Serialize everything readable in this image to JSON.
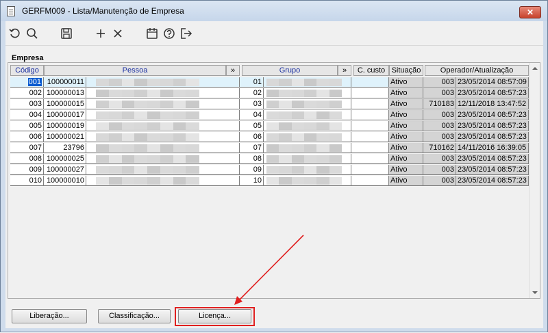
{
  "window": {
    "title": "GERFM009 - Lista/Manutenção de Empresa",
    "close_label": "✕"
  },
  "toolbar": {
    "icons": [
      "refresh-icon",
      "search-icon",
      "save-icon",
      "add-icon",
      "delete-icon",
      "calendar-icon",
      "help-icon",
      "exit-icon"
    ]
  },
  "group": {
    "label": "Empresa"
  },
  "grid": {
    "headers": {
      "codigo": "Código",
      "pessoa": "Pessoa",
      "pessoa_more": "»",
      "grupo": "Grupo",
      "grupo_more": "»",
      "ccusto": "C. custo",
      "situacao": "Situação",
      "operador": "Operador/Atualização"
    },
    "rows": [
      {
        "codigo": "001",
        "pessoa_id": "100000011",
        "grupo": "01",
        "situacao": "Ativo",
        "operador": "003",
        "atualizacao": "23/05/2014 08:57:09"
      },
      {
        "codigo": "002",
        "pessoa_id": "100000013",
        "grupo": "02",
        "situacao": "Ativo",
        "operador": "003",
        "atualizacao": "23/05/2014 08:57:23"
      },
      {
        "codigo": "003",
        "pessoa_id": "100000015",
        "grupo": "03",
        "situacao": "Ativo",
        "operador": "710183",
        "atualizacao": "12/11/2018 13:47:52"
      },
      {
        "codigo": "004",
        "pessoa_id": "100000017",
        "grupo": "04",
        "situacao": "Ativo",
        "operador": "003",
        "atualizacao": "23/05/2014 08:57:23"
      },
      {
        "codigo": "005",
        "pessoa_id": "100000019",
        "grupo": "05",
        "situacao": "Ativo",
        "operador": "003",
        "atualizacao": "23/05/2014 08:57:23"
      },
      {
        "codigo": "006",
        "pessoa_id": "100000021",
        "grupo": "06",
        "situacao": "Ativo",
        "operador": "003",
        "atualizacao": "23/05/2014 08:57:23"
      },
      {
        "codigo": "007",
        "pessoa_id": "23796",
        "grupo": "07",
        "situacao": "Ativo",
        "operador": "710162",
        "atualizacao": "14/11/2016 16:39:05"
      },
      {
        "codigo": "008",
        "pessoa_id": "100000025",
        "grupo": "08",
        "situacao": "Ativo",
        "operador": "003",
        "atualizacao": "23/05/2014 08:57:23"
      },
      {
        "codigo": "009",
        "pessoa_id": "100000027",
        "grupo": "09",
        "situacao": "Ativo",
        "operador": "003",
        "atualizacao": "23/05/2014 08:57:23"
      },
      {
        "codigo": "010",
        "pessoa_id": "100000010",
        "grupo": "10",
        "situacao": "Ativo",
        "operador": "003",
        "atualizacao": "23/05/2014 08:57:23"
      }
    ]
  },
  "buttons": {
    "liberacao": "Liberação...",
    "classificacao": "Classificação...",
    "licenca": "Licença..."
  },
  "colors": {
    "highlight": "#e02020",
    "selection": "#0a5bd0"
  }
}
